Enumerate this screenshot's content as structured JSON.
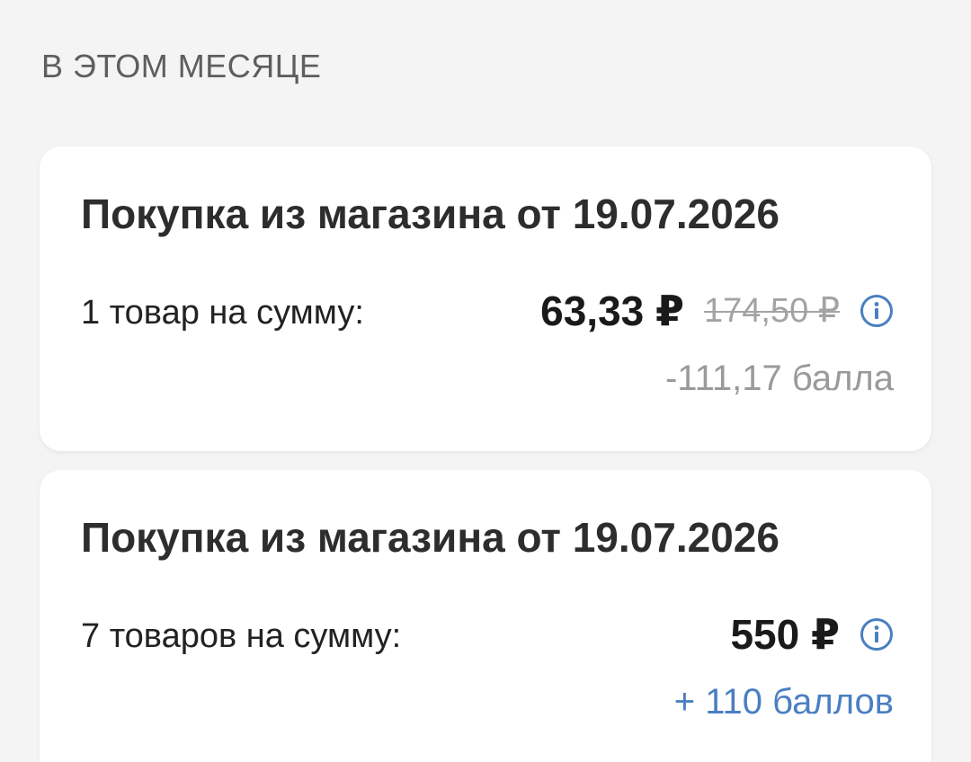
{
  "section": {
    "title": "В ЭТОМ МЕСЯЦЕ"
  },
  "purchases": [
    {
      "title": "Покупка из магазина от 19.07.2026",
      "items_label": "1 товар на сумму:",
      "price": "63,33 ₽",
      "old_price": "174,50 ₽",
      "bonus": "-111,17 балла",
      "bonus_type": "spent"
    },
    {
      "title": "Покупка из магазина от 19.07.2026",
      "items_label": "7 товаров на сумму:",
      "price": "550 ₽",
      "old_price": "",
      "bonus": "+ 110 баллов",
      "bonus_type": "earned"
    }
  ],
  "colors": {
    "background": "#f4f4f4",
    "card": "#ffffff",
    "accent_blue": "#4a7fc1",
    "muted_gray": "#9a9a9a"
  },
  "icons": {
    "info": "info-circle-icon"
  }
}
